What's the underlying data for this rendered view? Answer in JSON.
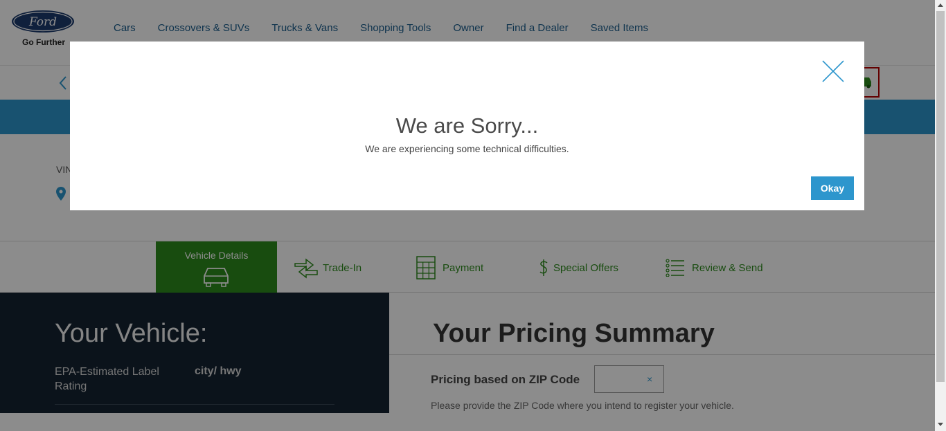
{
  "header": {
    "brand": "Ford",
    "tagline": "Go Further",
    "nav": [
      "Cars",
      "Crossovers & SUVs",
      "Trucks & Vans",
      "Shopping Tools",
      "Owner",
      "Find a Dealer",
      "Saved Items"
    ]
  },
  "vehicle_info": {
    "vin_label": "VIN"
  },
  "steps": {
    "vehicle_details": "Vehicle Details",
    "trade_in": "Trade-In",
    "payment": "Payment",
    "special_offers": "Special Offers",
    "review_send": "Review & Send"
  },
  "your_vehicle": {
    "title": "Your Vehicle:",
    "epa_label": "EPA-Estimated Label Rating",
    "epa_value": "city/ hwy"
  },
  "pricing": {
    "title": "Your Pricing Summary",
    "zip_label": "Pricing based on ZIP Code",
    "zip_value": "",
    "zip_clear": "×",
    "zip_help": "Please provide the ZIP Code where you intend to register your vehicle."
  },
  "modal": {
    "title": "We are Sorry...",
    "message": "We are experiencing some technical difficulties.",
    "ok_label": "Okay"
  },
  "colors": {
    "accent_blue": "#2d96cd",
    "step_green": "#2d8a1d",
    "dark_panel": "#142332",
    "nav_link": "#1a5d8d"
  }
}
